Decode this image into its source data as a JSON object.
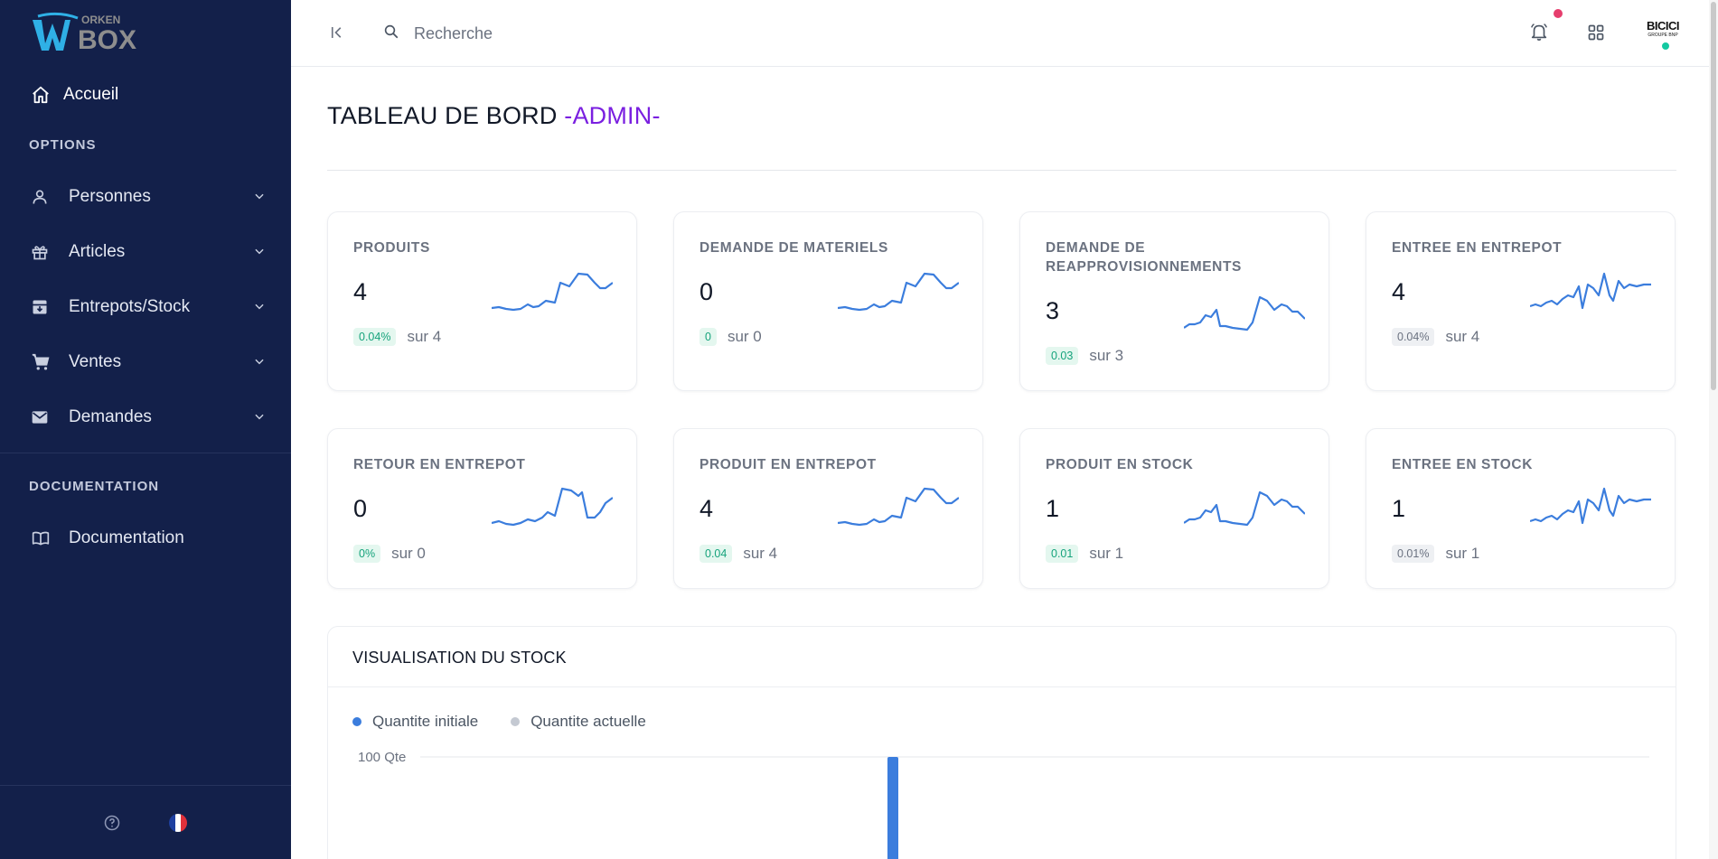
{
  "app": {
    "logo_text": "WORKEN BOX"
  },
  "sidebar": {
    "home_label": "Accueil",
    "options_label": "OPTIONS",
    "items": [
      {
        "label": "Personnes",
        "icon": "user-icon"
      },
      {
        "label": "Articles",
        "icon": "gift-icon"
      },
      {
        "label": "Entrepots/Stock",
        "icon": "archive-icon"
      },
      {
        "label": "Ventes",
        "icon": "cart-icon"
      },
      {
        "label": "Demandes",
        "icon": "mail-icon"
      }
    ],
    "documentation_section": "DOCUMENTATION",
    "documentation_label": "Documentation",
    "bottom_icons": [
      "help-icon",
      "flag-fr-icon"
    ]
  },
  "topbar": {
    "search_placeholder": "Recherche",
    "brand": "BICICI",
    "brand_sub": "GROUPE BNP"
  },
  "page": {
    "title": "TABLEAU DE BORD",
    "title_accent": "-ADMIN-"
  },
  "cards": [
    {
      "title": "PRODUITS",
      "value": "4",
      "badge": "0.04%",
      "badge_style": "green",
      "total": "sur 4"
    },
    {
      "title": "DEMANDE DE MATERIELS",
      "value": "0",
      "badge": "0",
      "badge_style": "green",
      "total": "sur 0"
    },
    {
      "title": "DEMANDE DE REAPPROVISIONNEMENTS",
      "value": "3",
      "badge": "0.03",
      "badge_style": "green",
      "total": "sur 3"
    },
    {
      "title": "ENTREE EN ENTREPOT",
      "value": "4",
      "badge": "0.04%",
      "badge_style": "gray",
      "total": "sur 4"
    },
    {
      "title": "RETOUR EN ENTREPOT",
      "value": "0",
      "badge": "0%",
      "badge_style": "green",
      "total": "sur 0"
    },
    {
      "title": "PRODUIT EN ENTREPOT",
      "value": "4",
      "badge": "0.04",
      "badge_style": "green",
      "total": "sur 4"
    },
    {
      "title": "PRODUIT EN STOCK",
      "value": "1",
      "badge": "0.01",
      "badge_style": "green",
      "total": "sur 1"
    },
    {
      "title": "ENTREE EN STOCK",
      "value": "1",
      "badge": "0.01%",
      "badge_style": "gray",
      "total": "sur 1"
    }
  ],
  "stock_panel": {
    "title": "VISUALISATION DU STOCK",
    "legend": [
      {
        "label": "Quantite initiale",
        "color": "#3b7ddd"
      },
      {
        "label": "Quantite actuelle",
        "color": "#c4c9d2"
      }
    ]
  },
  "chart_data": {
    "type": "bar",
    "title": "VISUALISATION DU STOCK",
    "series": [
      {
        "name": "Quantite initiale",
        "values": [
          100
        ]
      },
      {
        "name": "Quantite actuelle",
        "values": [
          0
        ]
      }
    ],
    "ytick_labels": [
      "100 Qte"
    ],
    "ylim": [
      0,
      100
    ],
    "legend_position": "top-left",
    "grid": true
  },
  "colors": {
    "sidebar_bg": "#13204a",
    "accent_purple": "#7a1fe0",
    "spark_blue": "#3b7ddd",
    "success_green": "#16a37c",
    "notification_red": "#e63e6d"
  }
}
